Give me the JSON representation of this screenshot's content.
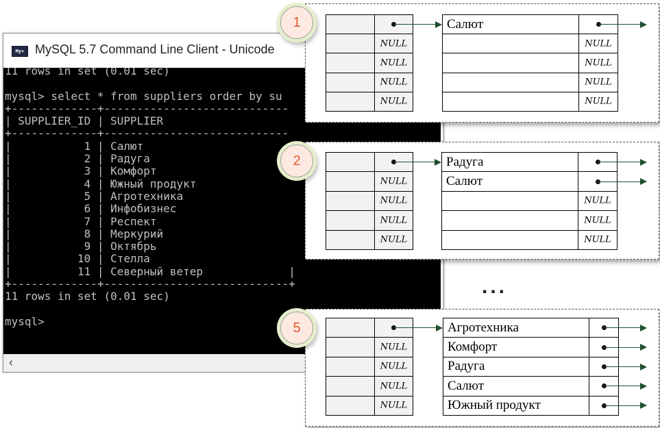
{
  "window": {
    "title": "MySQL 5.7 Command Line Client - Unicode",
    "icon": "mysql-console-icon",
    "icon_text": "My>"
  },
  "console": {
    "lines": [
      "11 rows in set (0.01 sec)",
      "",
      "mysql> select * from suppliers order by su",
      "+-------------+----------------------------",
      "| SUPPLIER_ID | SUPPLIER                   ",
      "+-------------+----------------------------",
      "|           1 | Салют                      ",
      "|           2 | Радуга                     ",
      "|           3 | Комфорт                    ",
      "|           4 | Южный продукт              ",
      "|           5 | Агротехника                ",
      "|           6 | Инфобизнес                 ",
      "|           7 | Респект                    ",
      "|           8 | Меркурий                   ",
      "|           9 | Октябрь                    ",
      "|          10 | Стелла                     ",
      "|          11 | Северный ветер             |",
      "+-------------+----------------------------+",
      "11 rows in set (0.01 sec)",
      "",
      "mysql> "
    ]
  },
  "diagram": {
    "null_label": "NULL",
    "ellipsis": "...",
    "steps": [
      {
        "badge": "1",
        "nodes": [
          "Салют",
          "",
          "",
          "",
          ""
        ]
      },
      {
        "badge": "2",
        "nodes": [
          "Радуга",
          "Салют",
          "",
          "",
          ""
        ]
      },
      {
        "badge": "5",
        "nodes": [
          "Агротехника",
          "Комфорт",
          "Радуга",
          "Салют",
          "Южный продукт"
        ]
      }
    ]
  },
  "colors": {
    "arrow": "#1f4f2e",
    "badge_text": "#e05a2a",
    "badge_fill": "#fde9e1",
    "badge_glow": "#e4f0cc"
  }
}
